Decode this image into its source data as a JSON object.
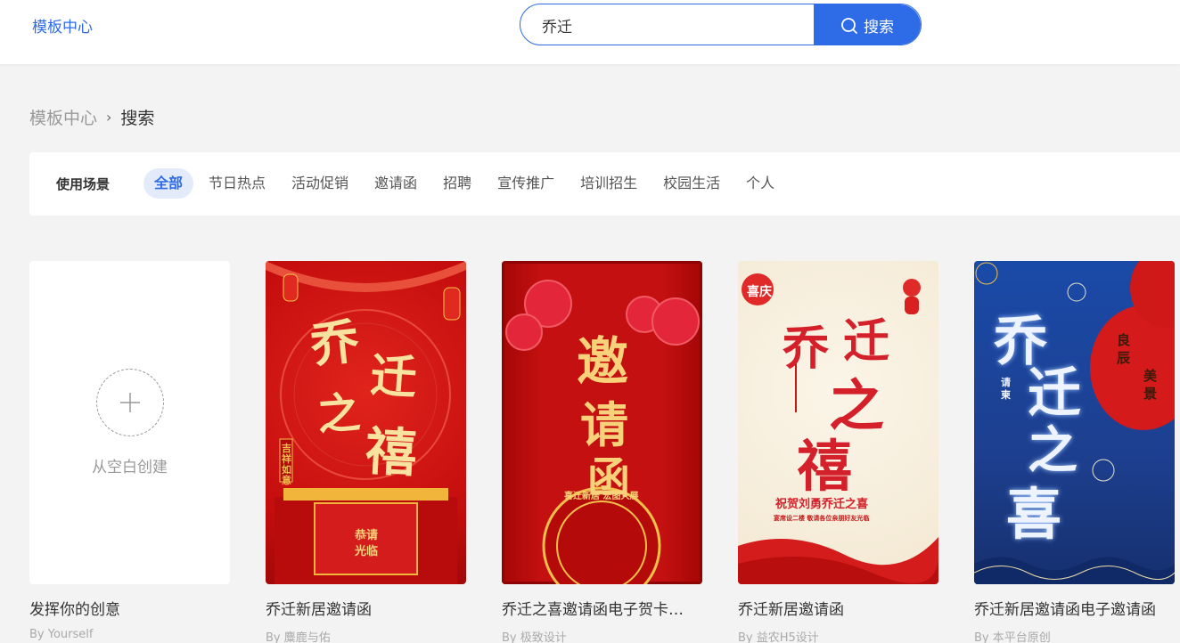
{
  "header": {
    "brand": "模板中心",
    "search_value": "乔迁",
    "search_button": "搜索"
  },
  "breadcrumb": {
    "root": "模板中心",
    "current": "搜索"
  },
  "filterbar": {
    "title": "使用场景",
    "items": [
      "全部",
      "节日热点",
      "活动促销",
      "邀请函",
      "招聘",
      "宣传推广",
      "培训招生",
      "校园生活",
      "个人"
    ],
    "active": "全部"
  },
  "blank_card": {
    "label": "从空白创建",
    "title": "发挥你的创意",
    "author": "By Yourself"
  },
  "templates": [
    {
      "title": "乔迁新居邀请函",
      "author": "By 麋鹿与佑",
      "art_chars": [
        "乔",
        "迁",
        "之",
        "禧"
      ],
      "art_small": [
        "吉",
        "祥",
        "如",
        "意"
      ],
      "art_gate": "恭请光临"
    },
    {
      "title": "乔迁之喜邀请函电子贺卡…",
      "author": "By 极致设计",
      "art_chars": [
        "邀",
        "请",
        "函"
      ],
      "art_sub": "喜迁新居  宏图大展"
    },
    {
      "title": "乔迁新居邀请函",
      "author": "By 益农H5设计",
      "art_chars": [
        "乔",
        "迁",
        "之",
        "禧"
      ],
      "art_badge": "喜庆",
      "art_sub": "祝贺刘勇乔迁之喜",
      "art_sub2": "宴席设二楼  敬请各位亲朋好友光临"
    },
    {
      "title": "乔迁新居邀请函电子邀请函",
      "author": "By 本平台原创",
      "art_chars": [
        "乔",
        "迁",
        "之",
        "喜"
      ],
      "art_side": "请柬",
      "art_lantern": [
        "良",
        "辰",
        "美",
        "景"
      ]
    }
  ],
  "colors": {
    "accent": "#2e6be6",
    "active_tab_bg": "#e3ebfb"
  }
}
